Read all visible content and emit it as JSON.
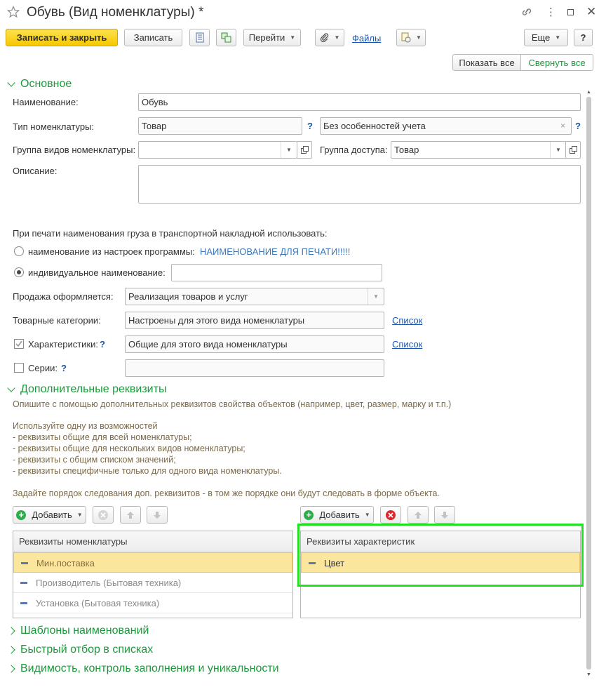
{
  "window": {
    "title": "Обувь (Вид номенклатуры) *"
  },
  "toolbar": {
    "save_close": "Записать и закрыть",
    "save": "Записать",
    "goto": "Перейти",
    "files": "Файлы",
    "more": "Еще",
    "help": "?"
  },
  "view": {
    "show_all": "Показать все",
    "collapse_all": "Свернуть все"
  },
  "main": {
    "section": "Основное",
    "name_label": "Наименование:",
    "name_value": "Обувь",
    "type_label": "Тип номенклатуры:",
    "type_value": "Товар",
    "type_help": "?",
    "accounting_value": "Без особенностей учета",
    "accounting_help": "?",
    "group_label": "Группа видов номенклатуры:",
    "group_value": "",
    "access_label": "Группа доступа:",
    "access_value": "Товар",
    "desc_label": "Описание:",
    "desc_value": "",
    "print_heading": "При печати наименования груза в транспортной накладной использовать:",
    "radio_settings_label": "наименование из настроек программы:",
    "radio_settings_value": "НАИМЕНОВАНИЕ ДЛЯ ПЕЧАТИ!!!!!",
    "radio_individual_label": "индивидуальное наименование:",
    "individual_value": "",
    "sale_label": "Продажа оформляется:",
    "sale_value": "Реализация товаров и услуг",
    "categories_label": "Товарные категории:",
    "categories_value": "Настроены для этого вида номенклатуры",
    "categories_link": "Список",
    "chars_label": "Характеристики:",
    "chars_help": "?",
    "chars_value": "Общие для этого вида номенклатуры",
    "chars_link": "Список",
    "series_label": "Серии:",
    "series_help": "?",
    "series_value": ""
  },
  "extra": {
    "section": "Дополнительные реквизиты",
    "hint1": "Опишите с помощью дополнительных реквизитов свойства объектов (например, цвет, размер, марку и т.п.)",
    "hint2": "Используйте одну из возможностей",
    "hint3": "- реквизиты общие для всей номенклатуры;",
    "hint4": "- реквизиты общие для нескольких видов номенклатуры;",
    "hint5": "- реквизиты с общим списком значений;",
    "hint6": "- реквизиты специфичные только для одного вида номенклатуры.",
    "hint7": "Задайте порядок следования доп. реквизитов - в том же порядке они будут следовать в форме объекта.",
    "add_label": "Добавить",
    "left_table": {
      "header": "Реквизиты номенклатуры",
      "rows": [
        "Мин.поставка",
        "Производитель (Бытовая техника)",
        "Установка (Бытовая техника)"
      ]
    },
    "right_table": {
      "header": "Реквизиты характеристик",
      "rows": [
        "Цвет"
      ]
    }
  },
  "collapsed_sections": [
    "Шаблоны наименований",
    "Быстрый отбор в списках",
    "Видимость, контроль заполнения и уникальности"
  ],
  "colors": {
    "accent_green": "#1a9a3a",
    "highlight_frame": "#22e022",
    "primary_button": "#f5c800",
    "link": "#1b55a8"
  }
}
